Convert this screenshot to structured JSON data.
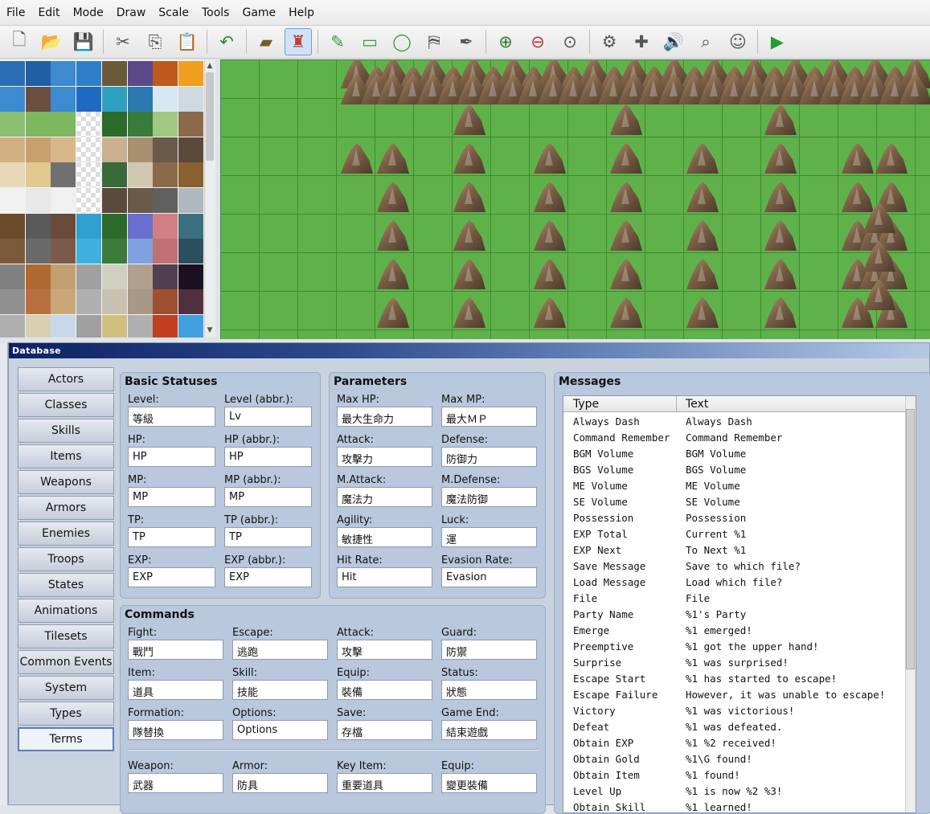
{
  "menu": [
    "File",
    "Edit",
    "Mode",
    "Draw",
    "Scale",
    "Tools",
    "Game",
    "Help"
  ],
  "toolbar_icons": [
    "new-project-icon",
    "open-project-icon",
    "save-project-icon",
    "cut-icon",
    "copy-icon",
    "paste-icon",
    "undo-icon",
    "map-mode-icon",
    "event-mode-icon",
    "pencil-icon",
    "rectangle-icon",
    "ellipse-icon",
    "fill-icon",
    "shadow-pen-icon",
    "zoom-in-icon",
    "zoom-out-icon",
    "actual-size-icon",
    "database-icon",
    "plugin-manager-icon",
    "sound-test-icon",
    "event-searcher-icon",
    "character-generator-icon",
    "playtest-icon"
  ],
  "database": {
    "title": "Database",
    "nav": [
      "Actors",
      "Classes",
      "Skills",
      "Items",
      "Weapons",
      "Armors",
      "Enemies",
      "Troops",
      "States",
      "Animations",
      "Tilesets",
      "Common Events",
      "System",
      "Types",
      "Terms"
    ],
    "selected": "Terms",
    "basic": {
      "title": "Basic Statuses",
      "fields": [
        {
          "label": "Level:",
          "value": "等級"
        },
        {
          "label": "Level (abbr.):",
          "value": "Lv"
        },
        {
          "label": "HP:",
          "value": "HP"
        },
        {
          "label": "HP (abbr.):",
          "value": "HP"
        },
        {
          "label": "MP:",
          "value": "MP"
        },
        {
          "label": "MP (abbr.):",
          "value": "MP"
        },
        {
          "label": "TP:",
          "value": "TP"
        },
        {
          "label": "TP (abbr.):",
          "value": "TP"
        },
        {
          "label": "EXP:",
          "value": "EXP"
        },
        {
          "label": "EXP (abbr.):",
          "value": "EXP"
        }
      ]
    },
    "params": {
      "title": "Parameters",
      "fields": [
        {
          "label": "Max HP:",
          "value": "最大生命力"
        },
        {
          "label": "Max MP:",
          "value": "最大ＭＰ"
        },
        {
          "label": "Attack:",
          "value": "攻擊力"
        },
        {
          "label": "Defense:",
          "value": "防御力"
        },
        {
          "label": "M.Attack:",
          "value": "魔法力"
        },
        {
          "label": "M.Defense:",
          "value": "魔法防御"
        },
        {
          "label": "Agility:",
          "value": "敏捷性"
        },
        {
          "label": "Luck:",
          "value": "運"
        },
        {
          "label": "Hit Rate:",
          "value": "Hit"
        },
        {
          "label": "Evasion Rate:",
          "value": "Evasion"
        }
      ]
    },
    "commands": {
      "title": "Commands",
      "fields": [
        {
          "label": "Fight:",
          "value": "戰鬥"
        },
        {
          "label": "Escape:",
          "value": "逃跑"
        },
        {
          "label": "Attack:",
          "value": "攻擊"
        },
        {
          "label": "Guard:",
          "value": "防禦"
        },
        {
          "label": "Item:",
          "value": "道具"
        },
        {
          "label": "Skill:",
          "value": "技能"
        },
        {
          "label": "Equip:",
          "value": "裝備"
        },
        {
          "label": "Status:",
          "value": "狀態"
        },
        {
          "label": "Formation:",
          "value": "隊替換"
        },
        {
          "label": "Options:",
          "value": "Options"
        },
        {
          "label": "Save:",
          "value": "存檔"
        },
        {
          "label": "Game End:",
          "value": "結束遊戲"
        },
        {
          "label": "Weapon:",
          "value": "武器"
        },
        {
          "label": "Armor:",
          "value": "防具"
        },
        {
          "label": "Key Item:",
          "value": "重要道具"
        },
        {
          "label": "Equip:",
          "value": "變更裝備"
        }
      ]
    },
    "messages": {
      "title": "Messages",
      "col_type": "Type",
      "col_text": "Text",
      "rows": [
        [
          "Always Dash",
          "Always Dash"
        ],
        [
          "Command Remember",
          "Command Remember"
        ],
        [
          "BGM Volume",
          "BGM Volume"
        ],
        [
          "BGS Volume",
          "BGS Volume"
        ],
        [
          "ME Volume",
          "ME Volume"
        ],
        [
          "SE Volume",
          "SE Volume"
        ],
        [
          "Possession",
          "Possession"
        ],
        [
          "EXP Total",
          "Current %1"
        ],
        [
          "EXP Next",
          "To Next %1"
        ],
        [
          "Save Message",
          "Save to which file?"
        ],
        [
          "Load Message",
          "Load which file?"
        ],
        [
          "File",
          "File"
        ],
        [
          "Party Name",
          "%1's Party"
        ],
        [
          "Emerge",
          "%1 emerged!"
        ],
        [
          "Preemptive",
          "%1 got the upper hand!"
        ],
        [
          "Surprise",
          "%1 was surprised!"
        ],
        [
          "Escape Start",
          "%1 has started to escape!"
        ],
        [
          "Escape Failure",
          "However, it was unable to escape!"
        ],
        [
          "Victory",
          "%1 was victorious!"
        ],
        [
          "Defeat",
          "%1 was defeated."
        ],
        [
          "Obtain EXP",
          "%1 %2 received!"
        ],
        [
          "Obtain Gold",
          "%1\\G found!"
        ],
        [
          "Obtain Item",
          "%1 found!"
        ],
        [
          "Level Up",
          "%1 is now %2 %3!"
        ],
        [
          "Obtain Skill",
          "%1 learned!"
        ]
      ]
    }
  },
  "colors": {
    "grass": "#5fb24a",
    "grid": "#3f8a32",
    "title_bar_start": "#0d2262",
    "panel": "#b9c8dc"
  }
}
